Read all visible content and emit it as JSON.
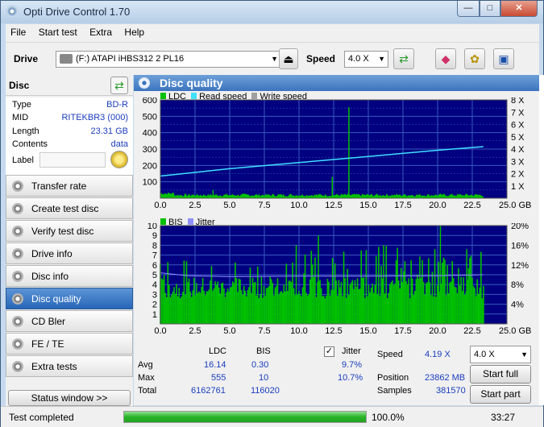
{
  "window": {
    "title": "Opti Drive Control 1.70",
    "min_label": "—",
    "max_label": "□",
    "close_label": "✕"
  },
  "menu": [
    "File",
    "Start test",
    "Extra",
    "Help"
  ],
  "toolbar": {
    "drive_label": "Drive",
    "drive_value": "(F:)   ATAPI iHBS312   2 PL16",
    "speed_label": "Speed",
    "speed_value": "4.0 X",
    "icons": [
      "eject-icon",
      "refresh-icon",
      "erase-icon",
      "settings-icon",
      "save-icon"
    ]
  },
  "disc_panel": {
    "title": "Disc",
    "rows": [
      {
        "key": "Type",
        "value": "BD-R"
      },
      {
        "key": "MID",
        "value": "RITEKBR3 (000)"
      },
      {
        "key": "Length",
        "value": "23.31 GB"
      },
      {
        "key": "Contents",
        "value": "data"
      },
      {
        "key": "Label",
        "value": ""
      }
    ]
  },
  "nav": [
    {
      "label": "Transfer rate",
      "active": false
    },
    {
      "label": "Create test disc",
      "active": false
    },
    {
      "label": "Verify test disc",
      "active": false
    },
    {
      "label": "Drive info",
      "active": false
    },
    {
      "label": "Disc info",
      "active": false
    },
    {
      "label": "Disc quality",
      "active": true
    },
    {
      "label": "CD Bler",
      "active": false
    },
    {
      "label": "FE / TE",
      "active": false
    },
    {
      "label": "Extra tests",
      "active": false
    }
  ],
  "status_window_label": "Status window >>",
  "main": {
    "title": "Disc quality",
    "top_legend": [
      "LDC",
      "Read speed",
      "Write speed"
    ],
    "bottom_legend": [
      "BIS",
      "Jitter"
    ],
    "colors": {
      "ldc": "#00c000",
      "read": "#40e0ff",
      "write": "#a0a0a0",
      "bis": "#00c000",
      "jitter": "#9090ff",
      "plot_bg": "#000080",
      "grid": "#3a5ac0"
    }
  },
  "chart_data": [
    {
      "type": "area",
      "title": "LDC / Read speed",
      "xlabel": "GB",
      "x_ticks": [
        "0.0",
        "2.5",
        "5.0",
        "7.5",
        "10.0",
        "12.5",
        "15.0",
        "17.5",
        "20.0",
        "22.5",
        "25.0 GB"
      ],
      "y_ticks_left": [
        "100",
        "200",
        "300",
        "400",
        "500",
        "600"
      ],
      "y_ticks_right": [
        "1 X",
        "2 X",
        "3 X",
        "4 X",
        "5 X",
        "6 X",
        "7 X",
        "8 X"
      ],
      "xlim": [
        0,
        25
      ],
      "ylim_left": [
        0,
        600
      ],
      "ylim_right": [
        0,
        8
      ],
      "series": [
        {
          "name": "LDC",
          "baseline": 16,
          "spikes": [
            {
              "x": 13.6,
              "y": 555
            },
            {
              "x": 12.4,
              "y": 130
            },
            {
              "x": 3.8,
              "y": 50
            }
          ]
        },
        {
          "name": "Read speed",
          "x": [
            0,
            5,
            10,
            15,
            20,
            23.3
          ],
          "y": [
            1.8,
            2.4,
            2.9,
            3.4,
            3.9,
            4.2
          ]
        }
      ]
    },
    {
      "type": "bar",
      "title": "BIS / Jitter",
      "xlabel": "GB",
      "x_ticks": [
        "0.0",
        "2.5",
        "5.0",
        "7.5",
        "10.0",
        "12.5",
        "15.0",
        "17.5",
        "20.0",
        "22.5",
        "25.0 GB"
      ],
      "y_ticks_left": [
        "1",
        "2",
        "3",
        "4",
        "5",
        "6",
        "7",
        "8",
        "9",
        "10"
      ],
      "y_ticks_right": [
        "4%",
        "8%",
        "12%",
        "16%",
        "20%"
      ],
      "xlim": [
        0,
        25
      ],
      "ylim_left": [
        0,
        10
      ],
      "ylim_right": [
        0,
        20
      ],
      "series": [
        {
          "name": "BIS",
          "avg": 0.3,
          "max": 10
        },
        {
          "name": "Jitter",
          "x": [
            0,
            2,
            5,
            10,
            15,
            20,
            23.3
          ],
          "y": [
            10.4,
            9.8,
            9.6,
            9.7,
            9.7,
            9.8,
            10.0
          ]
        }
      ]
    }
  ],
  "stats": {
    "headers": {
      "ldc": "LDC",
      "bis": "BIS",
      "jitter": "Jitter"
    },
    "jitter_checked": true,
    "rows": [
      {
        "label": "Avg",
        "ldc": "16.14",
        "bis": "0.30",
        "jitter": "9.7%"
      },
      {
        "label": "Max",
        "ldc": "555",
        "bis": "10",
        "jitter": "10.7%"
      },
      {
        "label": "Total",
        "ldc": "6162761",
        "bis": "116020",
        "jitter": ""
      }
    ],
    "speed_label": "Speed",
    "speed_value": "4.19 X",
    "position_label": "Position",
    "position_value": "23862 MB",
    "samples_label": "Samples",
    "samples_value": "381570",
    "speed_select": "4.0 X",
    "start_full": "Start full",
    "start_part": "Start part"
  },
  "statusbar": {
    "text": "Test completed",
    "progress": 100,
    "progress_label": "100.0%",
    "time": "33:27"
  }
}
